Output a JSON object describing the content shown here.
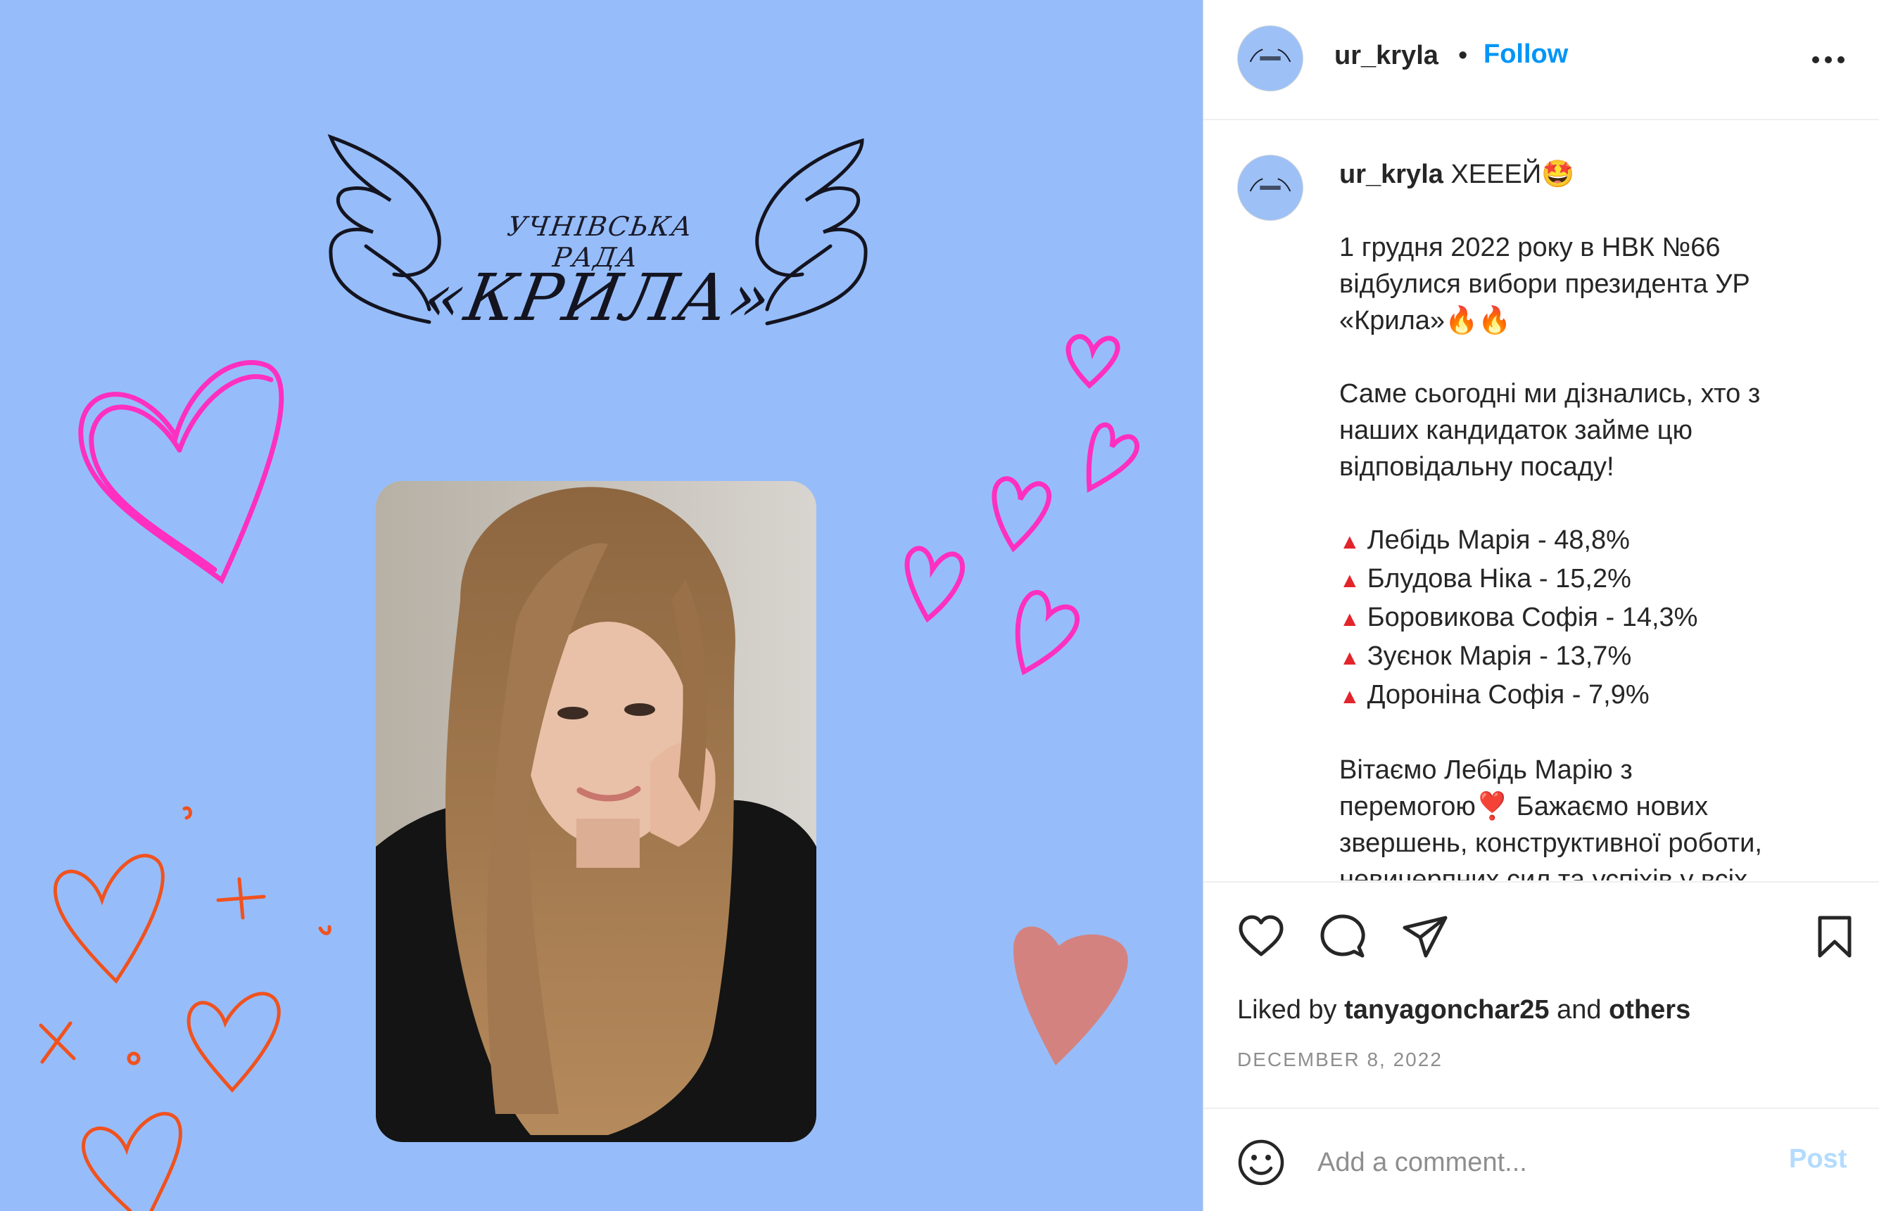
{
  "post": {
    "image": {
      "logo_line1": "УЧНІВСЬКА РАДА",
      "logo_line2": "«КРИЛА»",
      "background_color": "#96bdfa"
    },
    "header": {
      "username": "ur_kryla",
      "separator": "•",
      "follow_label": "Follow",
      "more_icon": "more-horizontal-icon"
    },
    "caption": {
      "username": "ur_kryla",
      "first_line": "ХЕЕЕЙ🤩",
      "paragraph1": [
        "1 грудня 2022 року в НВК №66",
        "відбулися вибори президента УР",
        "«Крила»🔥🔥"
      ],
      "paragraph2": [
        "Саме сьогодні ми дізнались, хто з",
        "наших кандидаток займе цю",
        "відповідальну посаду!"
      ],
      "results_marker": "▲",
      "results": [
        "Лебідь Марія - 48,8%",
        "Блудова Ніка - 15,2%",
        "Боровикова Софія - 14,3%",
        "Зуєнок Марія - 13,7%",
        "Доронiна Софiя - 7,9%"
      ],
      "paragraph3": [
        "Вітаємо Лебідь Марію з",
        "перемогою❣️ Бажаємо нових",
        "звершень, конструктивної роботи,",
        "невичерпних сил та успіхів у всіх"
      ]
    },
    "likes": {
      "prefix": "Liked by",
      "user": "tanyagonchar25",
      "middle": "and",
      "suffix": "others"
    },
    "date": "DECEMBER 8, 2022",
    "comment": {
      "placeholder": "Add a comment...",
      "post_label": "Post"
    },
    "colors": {
      "accent": "#0095f6",
      "post_disabled": "#b3dbff",
      "secondary_text": "#8e8e8e"
    }
  }
}
